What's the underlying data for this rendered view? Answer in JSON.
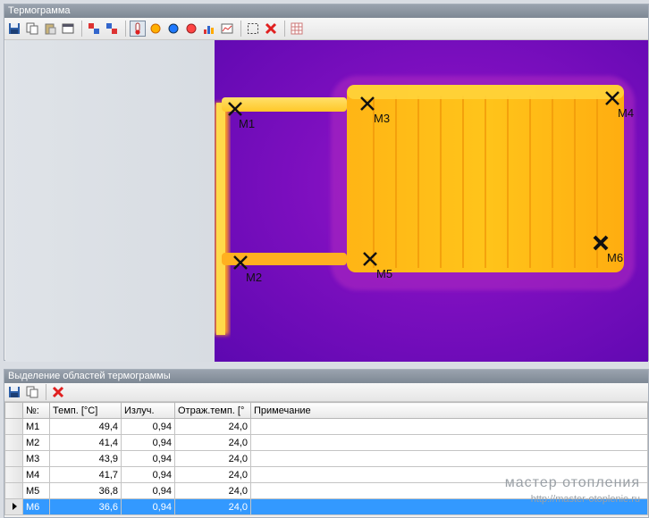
{
  "thermogram_panel": {
    "title": "Термограмма",
    "markers": [
      {
        "id": "M1",
        "label": "M1"
      },
      {
        "id": "M2",
        "label": "M2"
      },
      {
        "id": "M3",
        "label": "M3"
      },
      {
        "id": "M4",
        "label": "M4"
      },
      {
        "id": "M5",
        "label": "M5"
      },
      {
        "id": "M6",
        "label": "M6"
      }
    ],
    "toolbar_icons": [
      "save-icon",
      "copy-icon",
      "paste-icon",
      "window-icon",
      "swap-icon",
      "swap-alt-icon",
      "thermometer-icon",
      "spot-orange-icon",
      "spot-blue-icon",
      "spot-red-icon",
      "histogram-icon",
      "profile-icon",
      "selection-icon",
      "delete-icon",
      "grid-icon"
    ]
  },
  "regions_panel": {
    "title": "Выделение областей термограммы",
    "toolbar_icons": [
      "save-icon",
      "copy-icon",
      "delete-icon"
    ],
    "columns": [
      "№:",
      "Темп. [°C]",
      "Излуч.",
      "Отраж.темп. [°",
      "Примечание"
    ],
    "rows": [
      {
        "id": "M1",
        "temp": "49,4",
        "emiss": "0,94",
        "refl": "24,0",
        "note": ""
      },
      {
        "id": "M2",
        "temp": "41,4",
        "emiss": "0,94",
        "refl": "24,0",
        "note": ""
      },
      {
        "id": "M3",
        "temp": "43,9",
        "emiss": "0,94",
        "refl": "24,0",
        "note": ""
      },
      {
        "id": "M4",
        "temp": "41,7",
        "emiss": "0,94",
        "refl": "24,0",
        "note": ""
      },
      {
        "id": "M5",
        "temp": "36,8",
        "emiss": "0,94",
        "refl": "24,0",
        "note": ""
      },
      {
        "id": "M6",
        "temp": "36,6",
        "emiss": "0,94",
        "refl": "24,0",
        "note": ""
      }
    ],
    "selected_row": "M6"
  },
  "watermark": {
    "line1": "мастер отопления",
    "line2": "http://master-otoplenie.ru"
  },
  "colors": {
    "thermo_cold": "#5d08b0",
    "thermo_hot": "#ffd21c",
    "selection": "#3399ff"
  }
}
